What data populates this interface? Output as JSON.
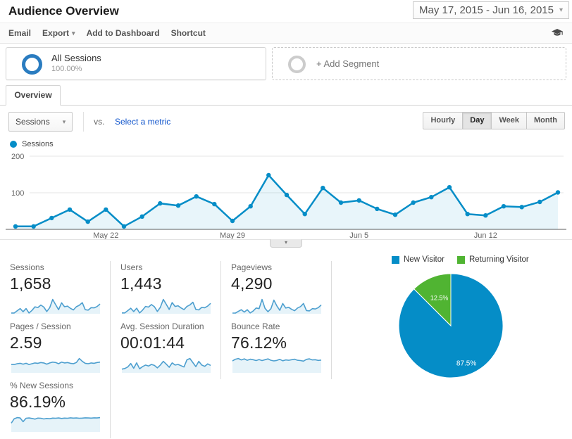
{
  "header": {
    "title": "Audience Overview",
    "date_range": "May 17, 2015 - Jun 16, 2015"
  },
  "toolbar": {
    "email": "Email",
    "export": "Export",
    "add_to_dashboard": "Add to Dashboard",
    "shortcut": "Shortcut"
  },
  "segments": {
    "all_sessions_label": "All Sessions",
    "all_sessions_percent": "100.00%",
    "add_segment_label": "+ Add Segment"
  },
  "tabs": {
    "overview": "Overview"
  },
  "controls": {
    "metric_select": "Sessions",
    "vs": "vs.",
    "select_metric": "Select a metric",
    "granularity": [
      "Hourly",
      "Day",
      "Week",
      "Month"
    ],
    "active_granularity": "Day"
  },
  "series_legend": "Sessions",
  "icons": {
    "caret": "▾"
  },
  "colors": {
    "line_blue": "#058dc7",
    "area_fill": "rgba(5,141,199,0.09)",
    "spark_blue": "#4d9fcf",
    "pie_blue": "#058dc7",
    "pie_green": "#50b432",
    "grid": "#e6e6e6",
    "axis": "#adadad",
    "tick_text": "#666666"
  },
  "chart_data": [
    {
      "type": "area",
      "title": "Sessions by day",
      "series_name": "Sessions",
      "x_start": "May 17, 2015",
      "x_end": "Jun 16, 2015",
      "x_tick_labels": [
        "May 22",
        "May 29",
        "Jun 5",
        "Jun 12"
      ],
      "x_tick_indices": [
        5,
        12,
        19,
        26
      ],
      "yticks": [
        100,
        200
      ],
      "ylim": [
        0,
        215
      ],
      "values": [
        8,
        8,
        31,
        54,
        21,
        54,
        8,
        35,
        71,
        65,
        90,
        69,
        23,
        63,
        148,
        94,
        42,
        113,
        73,
        79,
        56,
        40,
        73,
        88,
        115,
        42,
        38,
        63,
        61,
        75,
        101
      ],
      "grid": true,
      "legend_position": "top-left"
    },
    {
      "type": "pie",
      "title": "New vs Returning Visitors",
      "labels": [
        "New Visitor",
        "Returning Visitor"
      ],
      "values": [
        87.5,
        12.5
      ],
      "value_labels": [
        "87.5%",
        "12.5%"
      ],
      "colors": [
        "#058dc7",
        "#50b432"
      ],
      "legend_position": "top"
    }
  ],
  "metrics": [
    {
      "label": "Sessions",
      "value": "1,658",
      "spark": [
        8,
        8,
        31,
        54,
        21,
        54,
        8,
        35,
        71,
        65,
        90,
        69,
        23,
        63,
        148,
        94,
        42,
        113,
        73,
        79,
        56,
        40,
        73,
        88,
        115,
        42,
        38,
        63,
        61,
        75,
        101
      ]
    },
    {
      "label": "Users",
      "value": "1,443",
      "spark": [
        7,
        7,
        26,
        46,
        18,
        46,
        7,
        30,
        60,
        55,
        76,
        58,
        19,
        53,
        118,
        78,
        36,
        92,
        60,
        66,
        48,
        34,
        60,
        73,
        95,
        36,
        32,
        53,
        50,
        63,
        86
      ]
    },
    {
      "label": "Pageviews",
      "value": "4,290",
      "spark": [
        20,
        20,
        70,
        120,
        50,
        120,
        25,
        80,
        170,
        150,
        420,
        160,
        60,
        150,
        400,
        230,
        100,
        300,
        170,
        190,
        130,
        90,
        170,
        210,
        300,
        95,
        85,
        150,
        140,
        180,
        260
      ]
    },
    {
      "label": "Pages / Session",
      "value": "2.59",
      "spark": [
        2.1,
        2.1,
        2.3,
        2.4,
        2.2,
        2.4,
        2.1,
        2.3,
        2.5,
        2.4,
        2.6,
        2.5,
        2.2,
        2.5,
        2.7,
        2.6,
        2.3,
        2.7,
        2.5,
        2.6,
        2.4,
        2.3,
        2.6,
        3.6,
        2.9,
        2.4,
        2.3,
        2.5,
        2.4,
        2.6,
        2.7
      ]
    },
    {
      "label": "Avg. Session Duration",
      "value": "00:01:44",
      "spark": [
        60,
        70,
        95,
        150,
        75,
        160,
        65,
        100,
        125,
        110,
        135,
        120,
        80,
        125,
        185,
        140,
        90,
        160,
        125,
        135,
        115,
        95,
        210,
        230,
        165,
        100,
        185,
        125,
        105,
        145,
        120
      ]
    },
    {
      "label": "Bounce Rate",
      "value": "76.12%",
      "spark": [
        70,
        80,
        84,
        76,
        82,
        74,
        80,
        77,
        72,
        78,
        72,
        77,
        82,
        74,
        70,
        73,
        79,
        71,
        76,
        74,
        77,
        80,
        74,
        72,
        69,
        79,
        82,
        76,
        77,
        73,
        75
      ]
    },
    {
      "label": "% New Sessions",
      "value": "86.19%",
      "spark": [
        55,
        82,
        89,
        87,
        64,
        85,
        87,
        84,
        80,
        86,
        85,
        81,
        84,
        82,
        86,
        85,
        87,
        84,
        86,
        85,
        88,
        86,
        87,
        85,
        86,
        88,
        87,
        86,
        88,
        87,
        89
      ]
    }
  ]
}
